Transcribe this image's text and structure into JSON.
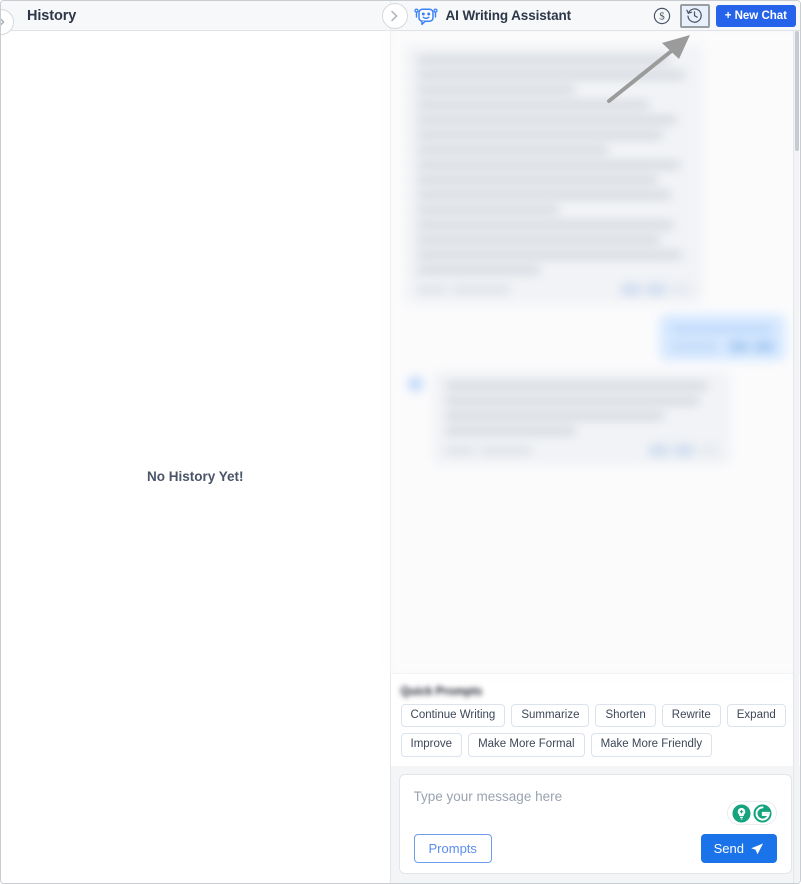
{
  "history_panel": {
    "title": "History",
    "empty_state": "No History Yet!",
    "collapse_icon": "chevron-right-icon"
  },
  "chat_panel": {
    "collapse_icon": "chevron-right-icon",
    "bot_icon": "robot-icon",
    "title": "AI Writing Assistant",
    "credits_icon": "dollar-circle-icon",
    "history_toggle_icon": "clock-history-icon",
    "new_chat_label": "+ New Chat"
  },
  "quick_prompts": {
    "label": "Quick Prompts",
    "chips": [
      "Continue Writing",
      "Summarize",
      "Shorten",
      "Rewrite",
      "Expand",
      "Improve",
      "Make More Formal",
      "Make More Friendly"
    ]
  },
  "composer": {
    "placeholder": "Type your message here",
    "value": "",
    "grammarly_icons": [
      "lightbulb-icon",
      "grammarly-g-icon"
    ],
    "prompts_label": "Prompts",
    "send_label": "Send",
    "send_icon": "paper-plane-icon"
  },
  "annotation": {
    "type": "arrow-pointer",
    "color": "#9b9b9b",
    "points_to": "history-toggle-button"
  },
  "colors": {
    "accent_blue": "#2563eb",
    "send_blue": "#1a73e8",
    "user_bubble": "#d9eaff",
    "bot_bubble": "#f1f3f6",
    "grammarly_green": "#15a47e",
    "header_bg": "#f7f8fa",
    "text_dark": "#2d3748"
  }
}
